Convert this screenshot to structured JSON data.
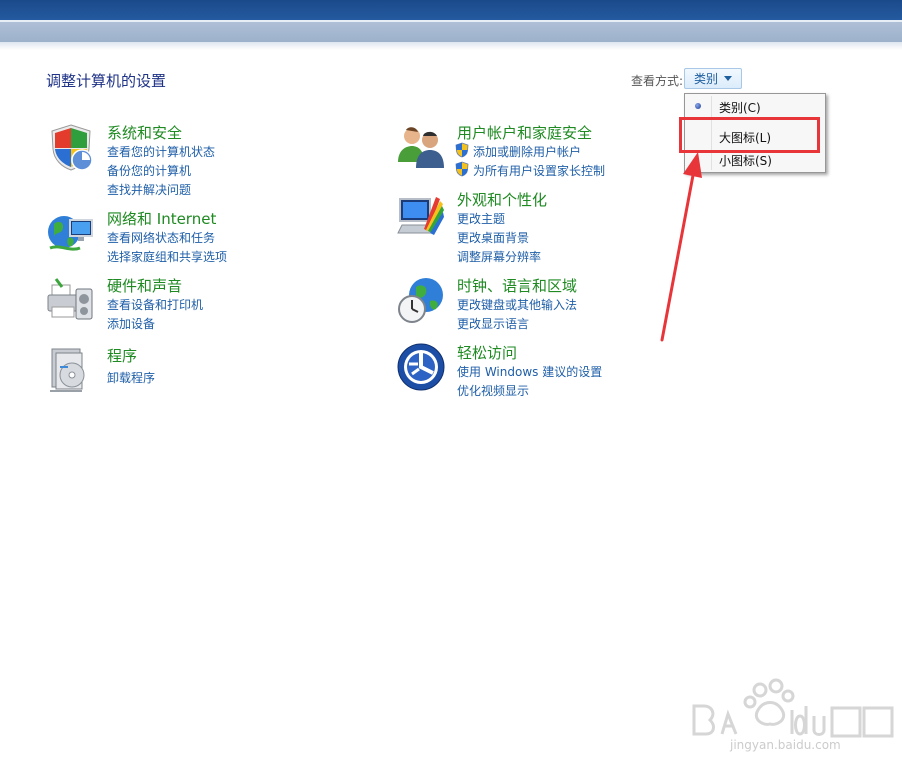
{
  "header": {
    "title": "调整计算机的设置",
    "view_label": "查看方式:",
    "view_value": "类别"
  },
  "view_menu": {
    "items": [
      {
        "label": "类别(C)",
        "selected": true
      },
      {
        "label": "大图标(L)",
        "selected": false
      },
      {
        "label": "小图标(S)",
        "selected": false
      }
    ]
  },
  "categories": {
    "system_security": {
      "title": "系统和安全",
      "icon": "shield-icon",
      "links": [
        "查看您的计算机状态",
        "备份您的计算机",
        "查找并解决问题"
      ]
    },
    "network": {
      "title": "网络和 Internet",
      "icon": "network-globe-icon",
      "links": [
        "查看网络状态和任务",
        "选择家庭组和共享选项"
      ]
    },
    "hardware": {
      "title": "硬件和声音",
      "icon": "printer-icon",
      "links": [
        "查看设备和打印机",
        "添加设备"
      ]
    },
    "programs": {
      "title": "程序",
      "icon": "programs-icon",
      "links": [
        "卸载程序"
      ]
    },
    "user_accounts": {
      "title": "用户帐户和家庭安全",
      "icon": "users-icon",
      "links": [
        "添加或删除用户帐户",
        "为所有用户设置家长控制"
      ]
    },
    "appearance": {
      "title": "外观和个性化",
      "icon": "monitor-palette-icon",
      "links": [
        "更改主题",
        "更改桌面背景",
        "调整屏幕分辨率"
      ]
    },
    "clock_region": {
      "title": "时钟、语言和区域",
      "icon": "clock-globe-icon",
      "links": [
        "更改键盘或其他输入法",
        "更改显示语言"
      ]
    },
    "ease_of_access": {
      "title": "轻松访问",
      "icon": "ease-of-access-icon",
      "links": [
        "使用 Windows 建议的设置",
        "优化视频显示"
      ]
    }
  },
  "watermark": {
    "text": "jingyan.baidu.com"
  },
  "colors": {
    "title_blue": "#1e3287",
    "category_green": "#1e8a21",
    "link_blue": "#1f5fa8",
    "highlight_red": "#e8353a"
  }
}
